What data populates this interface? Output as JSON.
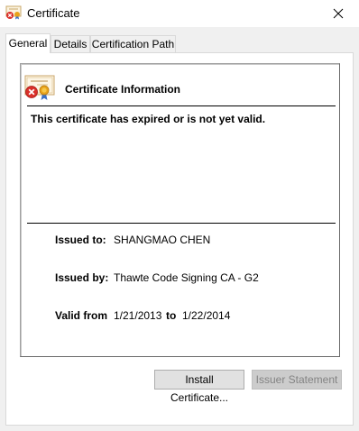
{
  "window": {
    "title": "Certificate",
    "title_icon": "certificate-warning-icon",
    "close_icon": "close-icon"
  },
  "tabs": [
    {
      "label": "General",
      "active": true
    },
    {
      "label": "Details",
      "active": false
    },
    {
      "label": "Certification Path",
      "active": false
    }
  ],
  "info": {
    "icon": "certificate-error-icon",
    "heading": "Certificate Information",
    "status_message": "This certificate has expired or is not yet valid."
  },
  "fields": {
    "issued_to_label": "Issued to:",
    "issued_to_value": "SHANGMAO CHEN",
    "issued_by_label": "Issued by:",
    "issued_by_value": "Thawte Code Signing CA - G2",
    "valid_from_label": "Valid from",
    "valid_from_value": "1/21/2013",
    "valid_to_label": "to",
    "valid_to_value": "1/22/2014"
  },
  "buttons": {
    "install": "Install Certificate...",
    "issuer_statement": "Issuer Statement"
  },
  "colors": {
    "error_red": "#d9302a",
    "seal_gold": "#e8a21a",
    "ribbon_blue": "#3a6fc4"
  }
}
